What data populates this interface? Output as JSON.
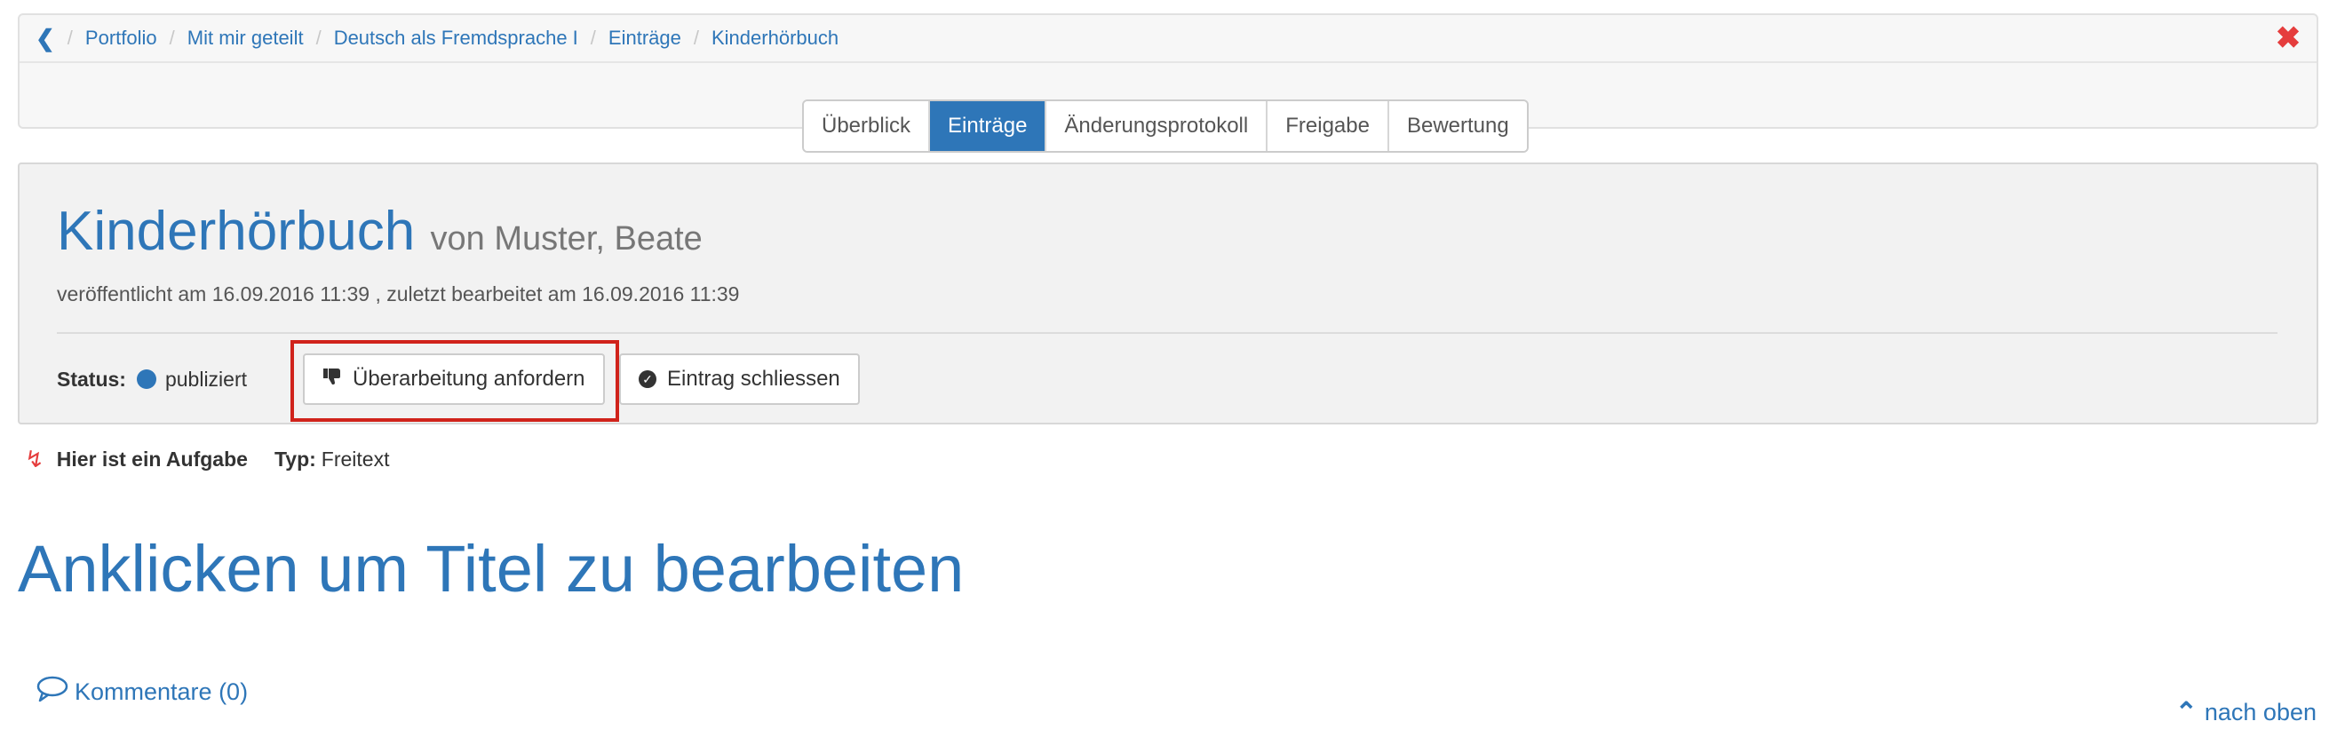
{
  "breadcrumb": {
    "items": [
      "Portfolio",
      "Mit mir geteilt",
      "Deutsch als Fremdsprache I",
      "Einträge",
      "Kinderhörbuch"
    ]
  },
  "tabs": [
    {
      "label": "Überblick"
    },
    {
      "label": "Einträge",
      "active": true
    },
    {
      "label": "Änderungsprotokoll"
    },
    {
      "label": "Freigabe"
    },
    {
      "label": "Bewertung"
    }
  ],
  "entry": {
    "title": "Kinderhörbuch",
    "author": "von Muster, Beate",
    "meta": "veröffentlicht am 16.09.2016 11:39 , zuletzt bearbeitet am 16.09.2016 11:39",
    "status_label": "Status:",
    "status_value": "publiziert",
    "request_revision_label": "Überarbeitung anfordern",
    "close_entry_label": "Eintrag schliessen"
  },
  "assignment": {
    "title": "Hier ist ein Aufgabe",
    "type_label": "Typ:",
    "type_value": "Freitext"
  },
  "page_title": "Anklicken um Titel zu bearbeiten",
  "comments_label": "Kommentare (0)",
  "back_to_top_label": "nach oben",
  "colors": {
    "accent": "#2e76b8",
    "close": "#e53d3d",
    "highlight": "#d0231b"
  }
}
